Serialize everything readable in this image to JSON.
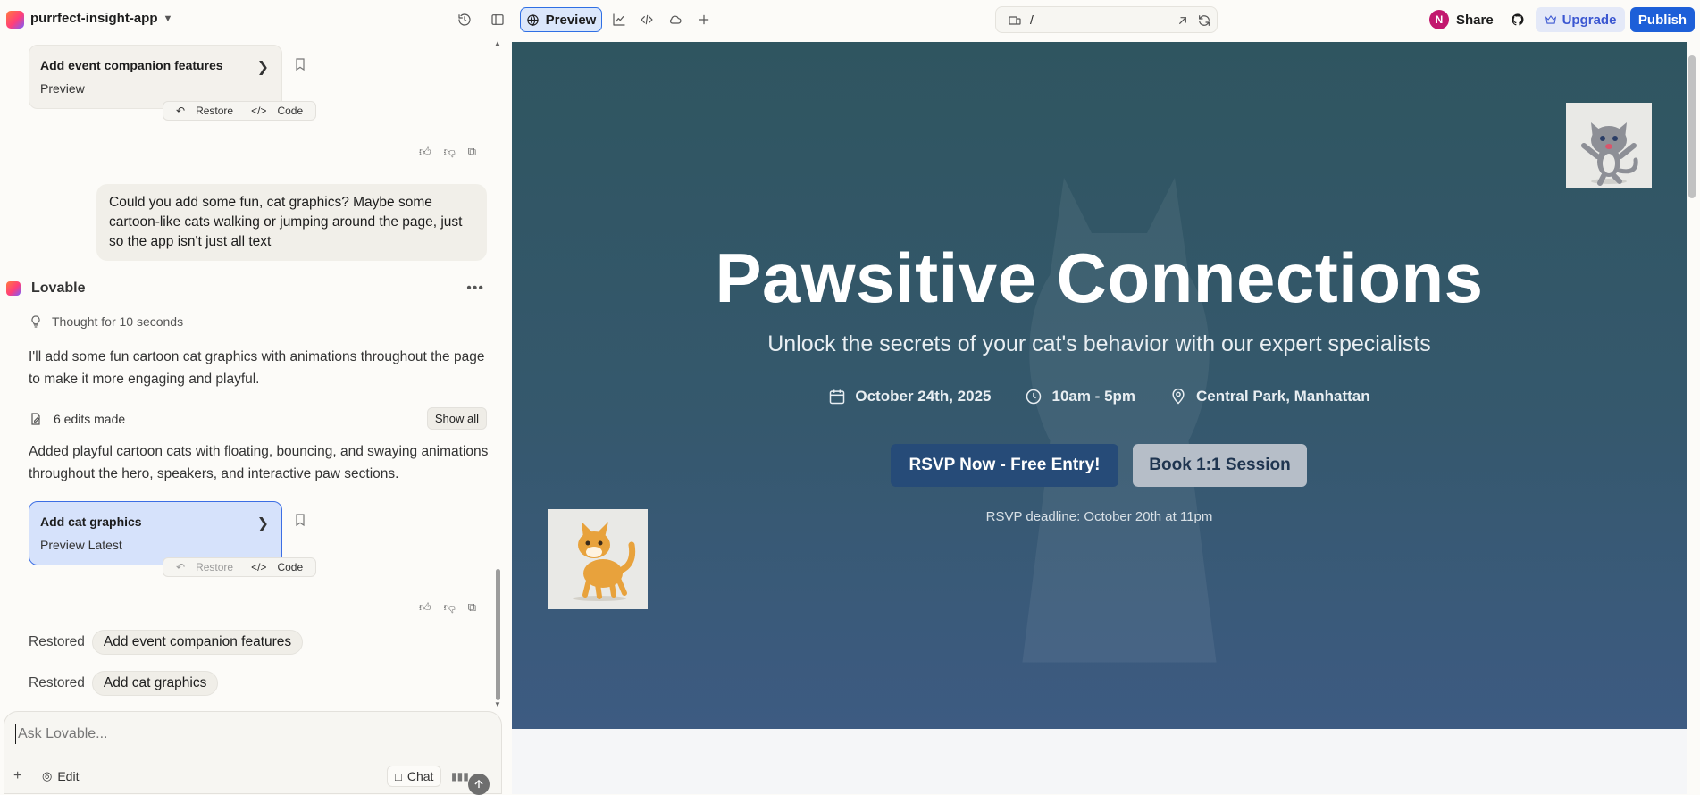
{
  "topbar": {
    "project_name": "purrfect-insight-app",
    "preview_tab_label": "Preview",
    "url_path": "/",
    "avatar_initial": "N",
    "share_label": "Share",
    "upgrade_label": "Upgrade",
    "publish_label": "Publish"
  },
  "chat": {
    "card1": {
      "title": "Add event companion features",
      "subtitle": "Preview",
      "restore_label": "Restore",
      "code_label": "Code"
    },
    "user_message": "Could you add some fun, cat graphics? Maybe some cartoon-like cats walking or jumping around the page, just so the app isn't just all text",
    "assistant_name": "Lovable",
    "thought": "Thought for 10 seconds",
    "reply_intro": "I'll add some fun cartoon cat graphics with animations throughout the page to make it more engaging and playful.",
    "edits_label": "6 edits made",
    "show_all_label": "Show all",
    "reply_summary": "Added playful cartoon cats with floating, bouncing, and swaying animations throughout the hero, speakers, and interactive paw sections.",
    "card2": {
      "title": "Add cat graphics",
      "subtitle": "Preview Latest",
      "restore_label": "Restore",
      "code_label": "Code"
    },
    "restored": [
      {
        "prefix": "Restored",
        "chip": "Add event companion features"
      },
      {
        "prefix": "Restored",
        "chip": "Add cat graphics"
      }
    ],
    "composer_placeholder": "Ask Lovable...",
    "edit_label": "Edit",
    "chat_label": "Chat"
  },
  "preview": {
    "title": "Pawsitive Connections",
    "subtitle": "Unlock the secrets of your cat's behavior with our expert specialists",
    "date": "October 24th, 2025",
    "time": "10am - 5pm",
    "location": "Central Park, Manhattan",
    "rsvp_button": "RSVP Now - Free Entry!",
    "book_button": "Book 1:1 Session",
    "deadline": "RSVP deadline: October 20th at 11pm"
  },
  "colors": {
    "accent": "#1d5fd8",
    "hero_top": "#2f5560",
    "hero_bottom": "#3d5b82",
    "rsvp_button": "#264b78",
    "book_button": "#b6bec8"
  }
}
